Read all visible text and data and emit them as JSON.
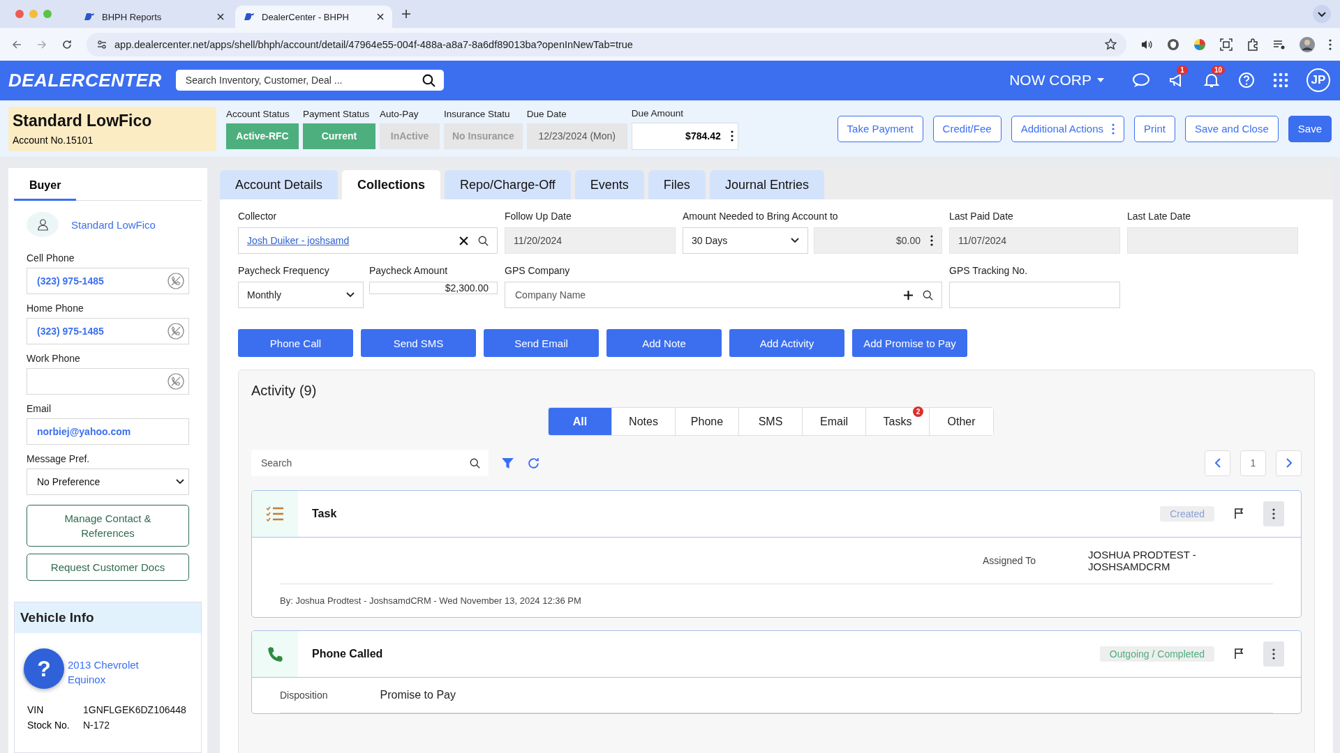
{
  "browser": {
    "tabs": [
      {
        "title": "BHPH Reports",
        "selected": false
      },
      {
        "title": "DealerCenter - BHPH",
        "selected": true
      }
    ],
    "url": "app.dealercenter.net/apps/shell/bhph/account/detail/47964e55-004f-488a-a8a7-8a6df89013ba?openInNewTab=true"
  },
  "header": {
    "logo": "DEALERCENTER",
    "search_placeholder": "Search Inventory, Customer, Deal ...",
    "company": "NOW CORP",
    "announcement_count": "1",
    "notification_count": "10",
    "avatar": "JP"
  },
  "account": {
    "name": "Standard LowFico",
    "number": "Account No.15101",
    "statuses": [
      {
        "label": "Account Status",
        "value": "Active-RFC",
        "kind": "green"
      },
      {
        "label": "Payment Status",
        "value": "Current",
        "kind": "green"
      },
      {
        "label": "Auto-Pay",
        "value": "InActive",
        "kind": "gray"
      },
      {
        "label": "Insurance Statu",
        "value": "No Insurance",
        "kind": "gray"
      },
      {
        "label": "Due Date",
        "value": "12/23/2024 (Mon)",
        "kind": "readonly"
      }
    ],
    "due_amount": {
      "label": "Due Amount",
      "value": "$784.42"
    },
    "actions": [
      {
        "label": "Take Payment",
        "kind": "outline"
      },
      {
        "label": "Credit/Fee",
        "kind": "outline"
      },
      {
        "label": "Additional Actions",
        "kind": "menu"
      },
      {
        "label": "Print",
        "kind": "outline"
      },
      {
        "label": "Save and Close",
        "kind": "outline"
      },
      {
        "label": "Save",
        "kind": "primary"
      }
    ]
  },
  "sidebar": {
    "tab": "Buyer",
    "buyer_name": "Standard LowFico",
    "fields": [
      {
        "label": "Cell Phone",
        "value": "(323) 975-1485",
        "kind": "phone"
      },
      {
        "label": "Home Phone",
        "value": "(323) 975-1485",
        "kind": "phone"
      },
      {
        "label": "Work Phone",
        "kind": "phone"
      },
      {
        "label": "Email",
        "value": "norbiej@yahoo.com",
        "kind": "email"
      },
      {
        "label": "Message Pref.",
        "value": "No Preference",
        "kind": "select"
      }
    ],
    "buttons": [
      "Manage Contact & References",
      "Request Customer Docs"
    ],
    "vehicle": {
      "title": "Vehicle Info",
      "name": "2013 Chevrolet Equinox",
      "rows": [
        {
          "label": "VIN",
          "value": "1GNFLGEK6DZ106448"
        },
        {
          "label": "Stock No.",
          "value": "N-172"
        }
      ]
    },
    "help_button": "?"
  },
  "tabs": [
    {
      "label": "Account Details",
      "selected": false
    },
    {
      "label": "Collections",
      "selected": true
    },
    {
      "label": "Repo/Charge-Off",
      "selected": false
    },
    {
      "label": "Events",
      "selected": false
    },
    {
      "label": "Files",
      "selected": false
    },
    {
      "label": "Journal Entries",
      "selected": false
    }
  ],
  "collections": {
    "collector": {
      "label": "Collector",
      "value": "Josh Duiker - joshsamd"
    },
    "follow_up_date": {
      "label": "Follow Up Date",
      "value": "11/20/2024"
    },
    "amount_needed": {
      "label": "Amount Needed to Bring Account to",
      "period": "30 Days",
      "amount": "$0.00"
    },
    "last_paid_date": {
      "label": "Last Paid Date",
      "value": "11/07/2024"
    },
    "last_late_date": {
      "label": "Last Late Date"
    },
    "paycheck_frequency": {
      "label": "Paycheck Frequency",
      "value": "Monthly"
    },
    "paycheck_amount": {
      "label": "Paycheck Amount",
      "value": "$2,300.00"
    },
    "gps_company": {
      "label": "GPS Company",
      "placeholder": "Company Name"
    },
    "gps_tracking_no": {
      "label": "GPS Tracking No."
    },
    "buttons": [
      "Phone Call",
      "Send SMS",
      "Send Email",
      "Add Note",
      "Add Activity",
      "Add Promise to Pay"
    ]
  },
  "activity": {
    "title": "Activity (9)",
    "filters": [
      {
        "label": "All",
        "selected": true
      },
      {
        "label": "Notes",
        "selected": false
      },
      {
        "label": "Phone",
        "selected": false
      },
      {
        "label": "SMS",
        "selected": false
      },
      {
        "label": "Email",
        "selected": false
      },
      {
        "label": "Tasks",
        "selected": false,
        "badge": "2"
      },
      {
        "label": "Other",
        "selected": false
      }
    ],
    "search_placeholder": "Search",
    "page": "1",
    "items": [
      {
        "kind": "task",
        "title": "Task",
        "status": "Created",
        "details": [
          {
            "label": "Assigned To",
            "value": "JOSHUA PRODTEST - JOSHSAMDCRM"
          }
        ],
        "footer": "By: Joshua Prodtest - JoshsamdCRM - Wed November 13, 2024 12:36 PM"
      },
      {
        "kind": "phone",
        "title": "Phone Called",
        "status": "Outgoing / Completed",
        "details": [
          {
            "label": "Disposition",
            "value": "Promise to Pay"
          }
        ]
      }
    ]
  }
}
